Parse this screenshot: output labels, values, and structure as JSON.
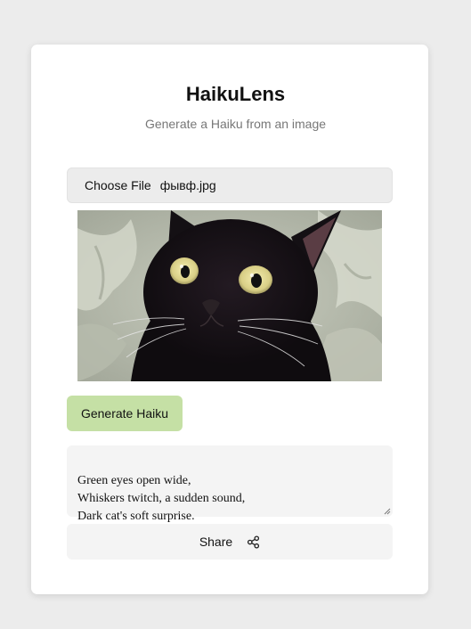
{
  "app": {
    "title": "HaikuLens",
    "subtitle": "Generate a Haiku from an image"
  },
  "file_input": {
    "button_label": "Choose File",
    "file_name": "фывф.jpg"
  },
  "preview": {
    "alt": "black cat photo"
  },
  "actions": {
    "generate_label": "Generate Haiku",
    "share_label": "Share",
    "share_icon": "share-icon",
    "generate_color": "#c5e0a5"
  },
  "haiku": {
    "text": "Green eyes open wide,\nWhiskers twitch, a sudden sound,\nDark cat's soft surprise."
  }
}
